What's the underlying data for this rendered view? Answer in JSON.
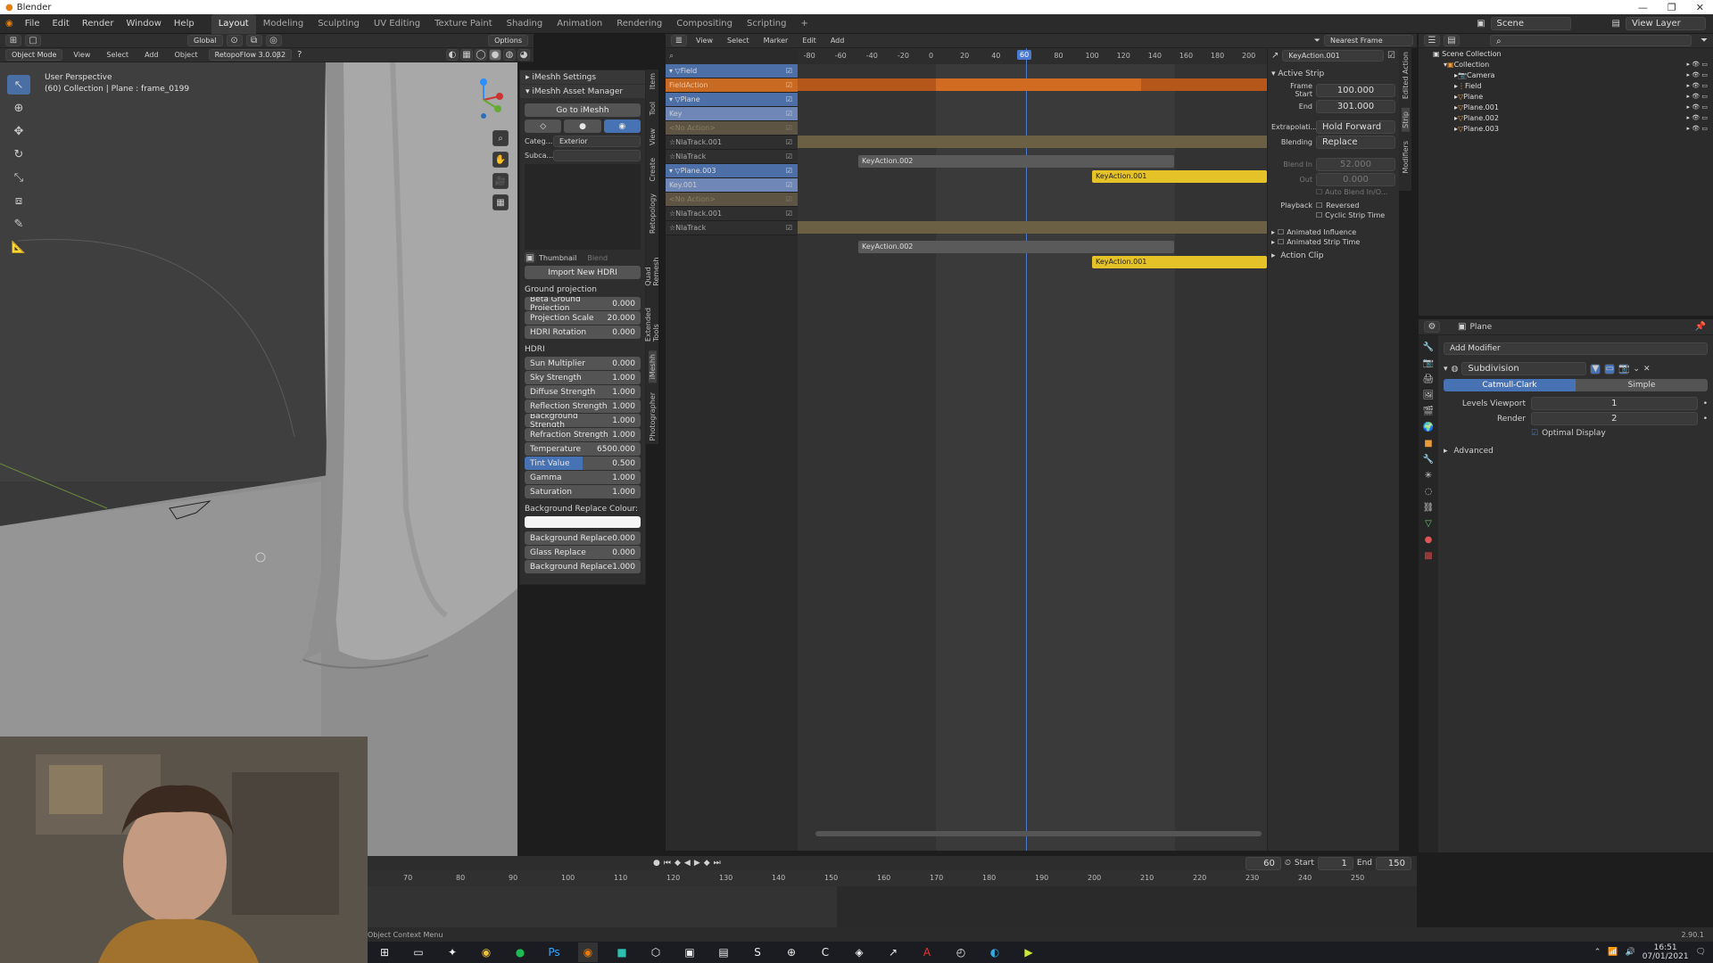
{
  "window": {
    "title": "Blender"
  },
  "menu": {
    "items": [
      "File",
      "Edit",
      "Render",
      "Window",
      "Help"
    ]
  },
  "workspaces": [
    "Layout",
    "Modeling",
    "Sculpting",
    "UV Editing",
    "Texture Paint",
    "Shading",
    "Animation",
    "Rendering",
    "Compositing",
    "Scripting"
  ],
  "workspaces_active": "Layout",
  "scene": {
    "name": "Scene",
    "view_layer": "View Layer"
  },
  "viewport": {
    "mode": "Object Mode",
    "menus": [
      "View",
      "Select",
      "Add",
      "Object"
    ],
    "orientation": "Global",
    "addon": "RetopoFlow 3.0.0β2",
    "options": "Options",
    "title": "User Perspective",
    "subtitle": "(60) Collection | Plane : frame_0199"
  },
  "imesh": {
    "settings": "iMeshh Settings",
    "asset_manager": "iMeshh Asset Manager",
    "goto": "Go to iMeshh",
    "categ_label": "Categ...",
    "categ_value": "Exterior",
    "subca_label": "Subca...",
    "subca_value": "",
    "thumbnail": "Thumbnail",
    "blend": "Blend",
    "import_hdri": "Import New HDRI",
    "ground_projection": "Ground projection",
    "hdri": "HDRI",
    "bg_replace_colour": "Background Replace Colour:",
    "ground_props": [
      {
        "label": "Beta Ground Projection",
        "value": "0.000"
      },
      {
        "label": "Projection Scale",
        "value": "20.000"
      },
      {
        "label": "HDRI Rotation",
        "value": "0.000"
      }
    ],
    "hdri_props": [
      {
        "label": "Sun Multiplier",
        "value": "0.000"
      },
      {
        "label": "Sky Strength",
        "value": "1.000"
      },
      {
        "label": "Diffuse Strength",
        "value": "1.000"
      },
      {
        "label": "Reflection Strength",
        "value": "1.000"
      },
      {
        "label": "Background Strength",
        "value": "1.000"
      },
      {
        "label": "Refraction Strength",
        "value": "1.000"
      },
      {
        "label": "Temperature",
        "value": "6500.000"
      }
    ],
    "tint": {
      "label": "Tint Value",
      "value": "0.500",
      "fraction": 0.5
    },
    "hdri_props2": [
      {
        "label": "Gamma",
        "value": "1.000"
      },
      {
        "label": "Saturation",
        "value": "1.000"
      }
    ],
    "replace_props": [
      {
        "label": "Background Replace",
        "value": "0.000"
      },
      {
        "label": "Glass Replace",
        "value": "0.000"
      },
      {
        "label": "Background Replace",
        "value": "1.000"
      }
    ]
  },
  "sidetabs": [
    "Item",
    "Tool",
    "View",
    "Create",
    "Retopology",
    "Quad Remesh",
    "Extended Tools",
    "iMeshh",
    "Photographer"
  ],
  "nla": {
    "menus": [
      "View",
      "Select",
      "Marker",
      "Edit",
      "Add"
    ],
    "snap": "Nearest Frame",
    "ticks": [
      "-80",
      "-60",
      "-40",
      "-20",
      "0",
      "20",
      "40",
      "60",
      "80",
      "100",
      "120",
      "140",
      "160",
      "180",
      "200"
    ],
    "current_frame": "60",
    "tracks": [
      {
        "name": "Field",
        "kind": "object"
      },
      {
        "name": "FieldAction",
        "kind": "action"
      },
      {
        "name": "Plane",
        "kind": "object"
      },
      {
        "name": "Key",
        "kind": "key"
      },
      {
        "name": "<No Action>",
        "kind": "noaction"
      },
      {
        "name": "NlaTrack.001",
        "kind": "track"
      },
      {
        "name": "NlaTrack",
        "kind": "track"
      },
      {
        "name": "Plane.003",
        "kind": "object"
      },
      {
        "name": "Key.001",
        "kind": "key"
      },
      {
        "name": "<No Action>",
        "kind": "noaction"
      },
      {
        "name": "NlaTrack.001",
        "kind": "track"
      },
      {
        "name": "NlaTrack",
        "kind": "track"
      }
    ],
    "strips": [
      "KeyAction.002",
      "KeyAction.001",
      "KeyAction.002",
      "KeyAction.001"
    ]
  },
  "strip_props": {
    "name": "KeyAction.001",
    "active_strip": "Active Strip",
    "frame_start_label": "Frame Start",
    "frame_start": "100.000",
    "end_label": "End",
    "end": "301.000",
    "extrapolation_label": "Extrapolati...",
    "extrapolation": "Hold Forward",
    "blending_label": "Blending",
    "blending": "Replace",
    "blend_in_label": "Blend In",
    "blend_in": "52.000",
    "out_label": "Out",
    "out": "0.000",
    "auto_blend": "Auto Blend In/O...",
    "playback": "Playback",
    "reversed": "Reversed",
    "cyclic": "Cyclic Strip Time",
    "animated_influence": "Animated Influence",
    "animated_strip_time": "Animated Strip Time",
    "action_clip": "Action Clip",
    "tabs": [
      "Edited Action",
      "Strip",
      "Modifiers"
    ]
  },
  "outliner": {
    "root": "Scene Collection",
    "items": [
      {
        "name": "Collection",
        "depth": 1
      },
      {
        "name": "Camera",
        "depth": 2
      },
      {
        "name": "Field",
        "depth": 2
      },
      {
        "name": "Plane",
        "depth": 2
      },
      {
        "name": "Plane.001",
        "depth": 2
      },
      {
        "name": "Plane.002",
        "depth": 2
      },
      {
        "name": "Plane.003",
        "depth": 2
      }
    ]
  },
  "properties": {
    "object": "Plane",
    "add_modifier": "Add Modifier",
    "modifier": "Subdivision",
    "catmull": "Catmull-Clark",
    "simple": "Simple",
    "levels_viewport_label": "Levels Viewport",
    "levels_viewport": "1",
    "render_label": "Render",
    "render": "2",
    "optimal": "Optimal Display",
    "advanced": "Advanced"
  },
  "timeline": {
    "ticks": [
      "70",
      "80",
      "90",
      "100",
      "110",
      "120",
      "130",
      "140",
      "150",
      "160",
      "170",
      "180",
      "190",
      "200",
      "210",
      "220",
      "230",
      "240",
      "250"
    ],
    "current": "60",
    "start_label": "Start",
    "start": "1",
    "end_label": "End",
    "end": "150"
  },
  "status": {
    "left": "Object Context Menu",
    "version": "2.90.1"
  },
  "taskbar": {
    "time": "16:51",
    "date": "07/01/2021"
  }
}
